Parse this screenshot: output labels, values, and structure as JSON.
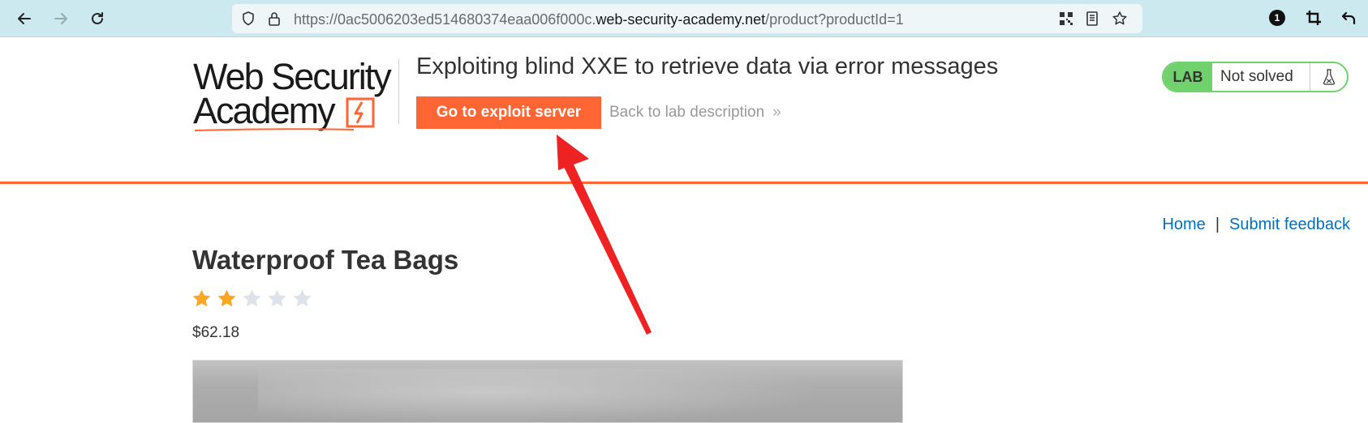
{
  "browser": {
    "url_prefix": "https://0ac5006203ed514680374eaa006f000c.",
    "url_domain": "web-security-academy.net",
    "url_path": "/product?productId=1",
    "extension_badge": "1"
  },
  "header": {
    "logo_line1": "Web Security",
    "logo_line2": "Academy",
    "lab_title": "Exploiting blind XXE to retrieve data via error messages",
    "exploit_button": "Go to exploit server",
    "back_link": "Back to lab description",
    "back_chevron": "»",
    "lab_tag": "LAB",
    "lab_status": "Not solved"
  },
  "nav": {
    "home": "Home",
    "separator": "|",
    "feedback": "Submit feedback"
  },
  "product": {
    "title": "Waterproof Tea Bags",
    "rating": 2,
    "rating_max": 5,
    "price": "$62.18"
  },
  "colors": {
    "brand_orange": "#ff6633",
    "lab_green": "#70d16d",
    "link_blue": "#0071bc",
    "star_filled": "#f9a825",
    "star_empty": "#dde3ea",
    "annotation_red": "#ee2222"
  }
}
